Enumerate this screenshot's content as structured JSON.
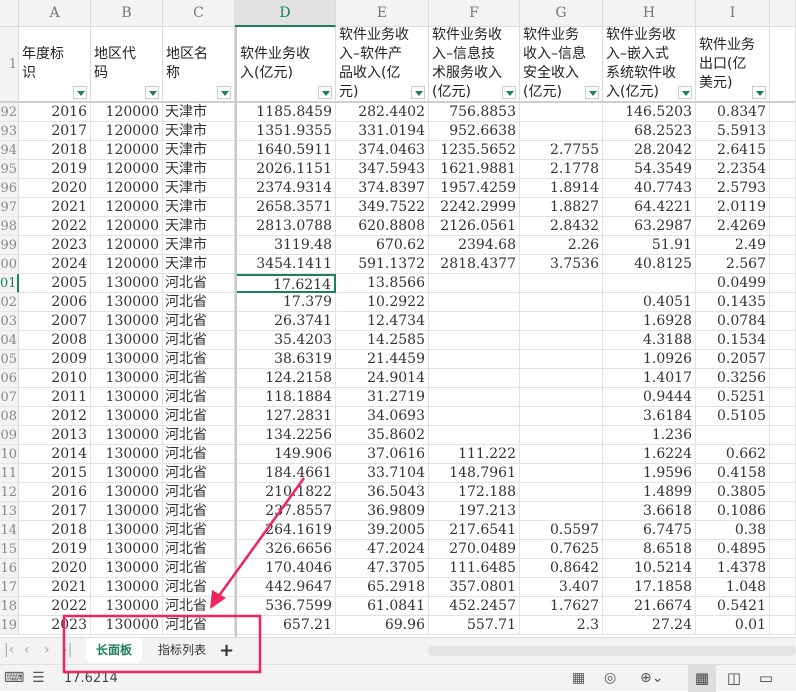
{
  "columns": [
    "A",
    "B",
    "C",
    "D",
    "E",
    "F",
    "G",
    "H",
    "I"
  ],
  "header_row_number": "1",
  "headers": [
    "年度标识",
    "地区代码",
    "地区名称",
    "软件业务收入(亿元)",
    "软件业务收入–软件产品收入(亿元)",
    "软件业务收入–信息技术服务收入(亿元)",
    "软件业务收入–信息安全收入(亿元)",
    "软件业务收入–嵌入式系统软件收入(亿元)",
    "软件业务出口(亿美元)"
  ],
  "rows": [
    {
      "n": "92",
      "v": [
        "2016",
        "120000",
        "天津市",
        "1185.8459",
        "282.4402",
        "756.8853",
        "",
        "146.5203",
        "0.8347"
      ]
    },
    {
      "n": "93",
      "v": [
        "2017",
        "120000",
        "天津市",
        "1351.9355",
        "331.0194",
        "952.6638",
        "",
        "68.2523",
        "5.5913"
      ]
    },
    {
      "n": "94",
      "v": [
        "2018",
        "120000",
        "天津市",
        "1640.5911",
        "374.0463",
        "1235.5652",
        "2.7755",
        "28.2042",
        "2.6415"
      ]
    },
    {
      "n": "95",
      "v": [
        "2019",
        "120000",
        "天津市",
        "2026.1151",
        "347.5943",
        "1621.9881",
        "2.1778",
        "54.3549",
        "2.2354"
      ]
    },
    {
      "n": "96",
      "v": [
        "2020",
        "120000",
        "天津市",
        "2374.9314",
        "374.8397",
        "1957.4259",
        "1.8914",
        "40.7743",
        "2.5793"
      ]
    },
    {
      "n": "97",
      "v": [
        "2021",
        "120000",
        "天津市",
        "2658.3571",
        "349.7522",
        "2242.2999",
        "1.8827",
        "64.4221",
        "2.0119"
      ]
    },
    {
      "n": "98",
      "v": [
        "2022",
        "120000",
        "天津市",
        "2813.0788",
        "620.8808",
        "2126.0561",
        "2.8432",
        "63.2987",
        "2.4269"
      ]
    },
    {
      "n": "99",
      "v": [
        "2023",
        "120000",
        "天津市",
        "3119.48",
        "670.62",
        "2394.68",
        "2.26",
        "51.91",
        "2.49"
      ]
    },
    {
      "n": "00",
      "v": [
        "2024",
        "120000",
        "天津市",
        "3454.1411",
        "591.1372",
        "2818.4377",
        "3.7536",
        "40.8125",
        "2.567"
      ]
    },
    {
      "n": "01",
      "v": [
        "2005",
        "130000",
        "河北省",
        "17.6214",
        "13.8566",
        "",
        "",
        "",
        "0.0499"
      ]
    },
    {
      "n": "02",
      "v": [
        "2006",
        "130000",
        "河北省",
        "17.379",
        "10.2922",
        "",
        "",
        "0.4051",
        "0.1435"
      ]
    },
    {
      "n": "03",
      "v": [
        "2007",
        "130000",
        "河北省",
        "26.3741",
        "12.4734",
        "",
        "",
        "1.6928",
        "0.0784"
      ]
    },
    {
      "n": "04",
      "v": [
        "2008",
        "130000",
        "河北省",
        "35.4203",
        "14.2585",
        "",
        "",
        "4.3188",
        "0.1534"
      ]
    },
    {
      "n": "05",
      "v": [
        "2009",
        "130000",
        "河北省",
        "38.6319",
        "21.4459",
        "",
        "",
        "1.0926",
        "0.2057"
      ]
    },
    {
      "n": "06",
      "v": [
        "2010",
        "130000",
        "河北省",
        "124.2158",
        "24.9014",
        "",
        "",
        "1.4017",
        "0.3256"
      ]
    },
    {
      "n": "07",
      "v": [
        "2011",
        "130000",
        "河北省",
        "118.1884",
        "31.2719",
        "",
        "",
        "0.9444",
        "0.5251"
      ]
    },
    {
      "n": "08",
      "v": [
        "2012",
        "130000",
        "河北省",
        "127.2831",
        "34.0693",
        "",
        "",
        "3.6184",
        "0.5105"
      ]
    },
    {
      "n": "09",
      "v": [
        "2013",
        "130000",
        "河北省",
        "134.2256",
        "35.8602",
        "",
        "",
        "1.236",
        ""
      ]
    },
    {
      "n": "10",
      "v": [
        "2014",
        "130000",
        "河北省",
        "149.906",
        "37.0616",
        "111.222",
        "",
        "1.6224",
        "0.662"
      ]
    },
    {
      "n": "11",
      "v": [
        "2015",
        "130000",
        "河北省",
        "184.4661",
        "33.7104",
        "148.7961",
        "",
        "1.9596",
        "0.4158"
      ]
    },
    {
      "n": "12",
      "v": [
        "2016",
        "130000",
        "河北省",
        "210.1822",
        "36.5043",
        "172.188",
        "",
        "1.4899",
        "0.3805"
      ]
    },
    {
      "n": "13",
      "v": [
        "2017",
        "130000",
        "河北省",
        "237.8557",
        "36.9809",
        "197.213",
        "",
        "3.6618",
        "0.1086"
      ]
    },
    {
      "n": "14",
      "v": [
        "2018",
        "130000",
        "河北省",
        "264.1619",
        "39.2005",
        "217.6541",
        "0.5597",
        "6.7475",
        "0.38"
      ]
    },
    {
      "n": "15",
      "v": [
        "2019",
        "130000",
        "河北省",
        "326.6656",
        "47.2024",
        "270.0489",
        "0.7625",
        "8.6518",
        "0.4895"
      ]
    },
    {
      "n": "16",
      "v": [
        "2020",
        "130000",
        "河北省",
        "170.4046",
        "47.3705",
        "111.6485",
        "0.8642",
        "10.5214",
        "1.4378"
      ]
    },
    {
      "n": "17",
      "v": [
        "2021",
        "130000",
        "河北省",
        "442.9647",
        "65.2918",
        "357.0801",
        "3.407",
        "17.1858",
        "1.048"
      ]
    },
    {
      "n": "18",
      "v": [
        "2022",
        "130000",
        "河北省",
        "536.7599",
        "61.0841",
        "452.2457",
        "1.7627",
        "21.6674",
        "0.5421"
      ]
    },
    {
      "n": "19",
      "v": [
        "2023",
        "130000",
        "河北省",
        "657.21",
        "69.96",
        "557.71",
        "2.3",
        "27.24",
        "0.01"
      ]
    }
  ],
  "sheet_tabs": [
    {
      "label": "长面板"
    },
    {
      "label": "指标列表"
    }
  ],
  "add_tab_label": "+",
  "status": {
    "cell_value": "17.6214"
  },
  "colors": {
    "accent": "#1e7f5c",
    "annotation": "#f0265a"
  }
}
